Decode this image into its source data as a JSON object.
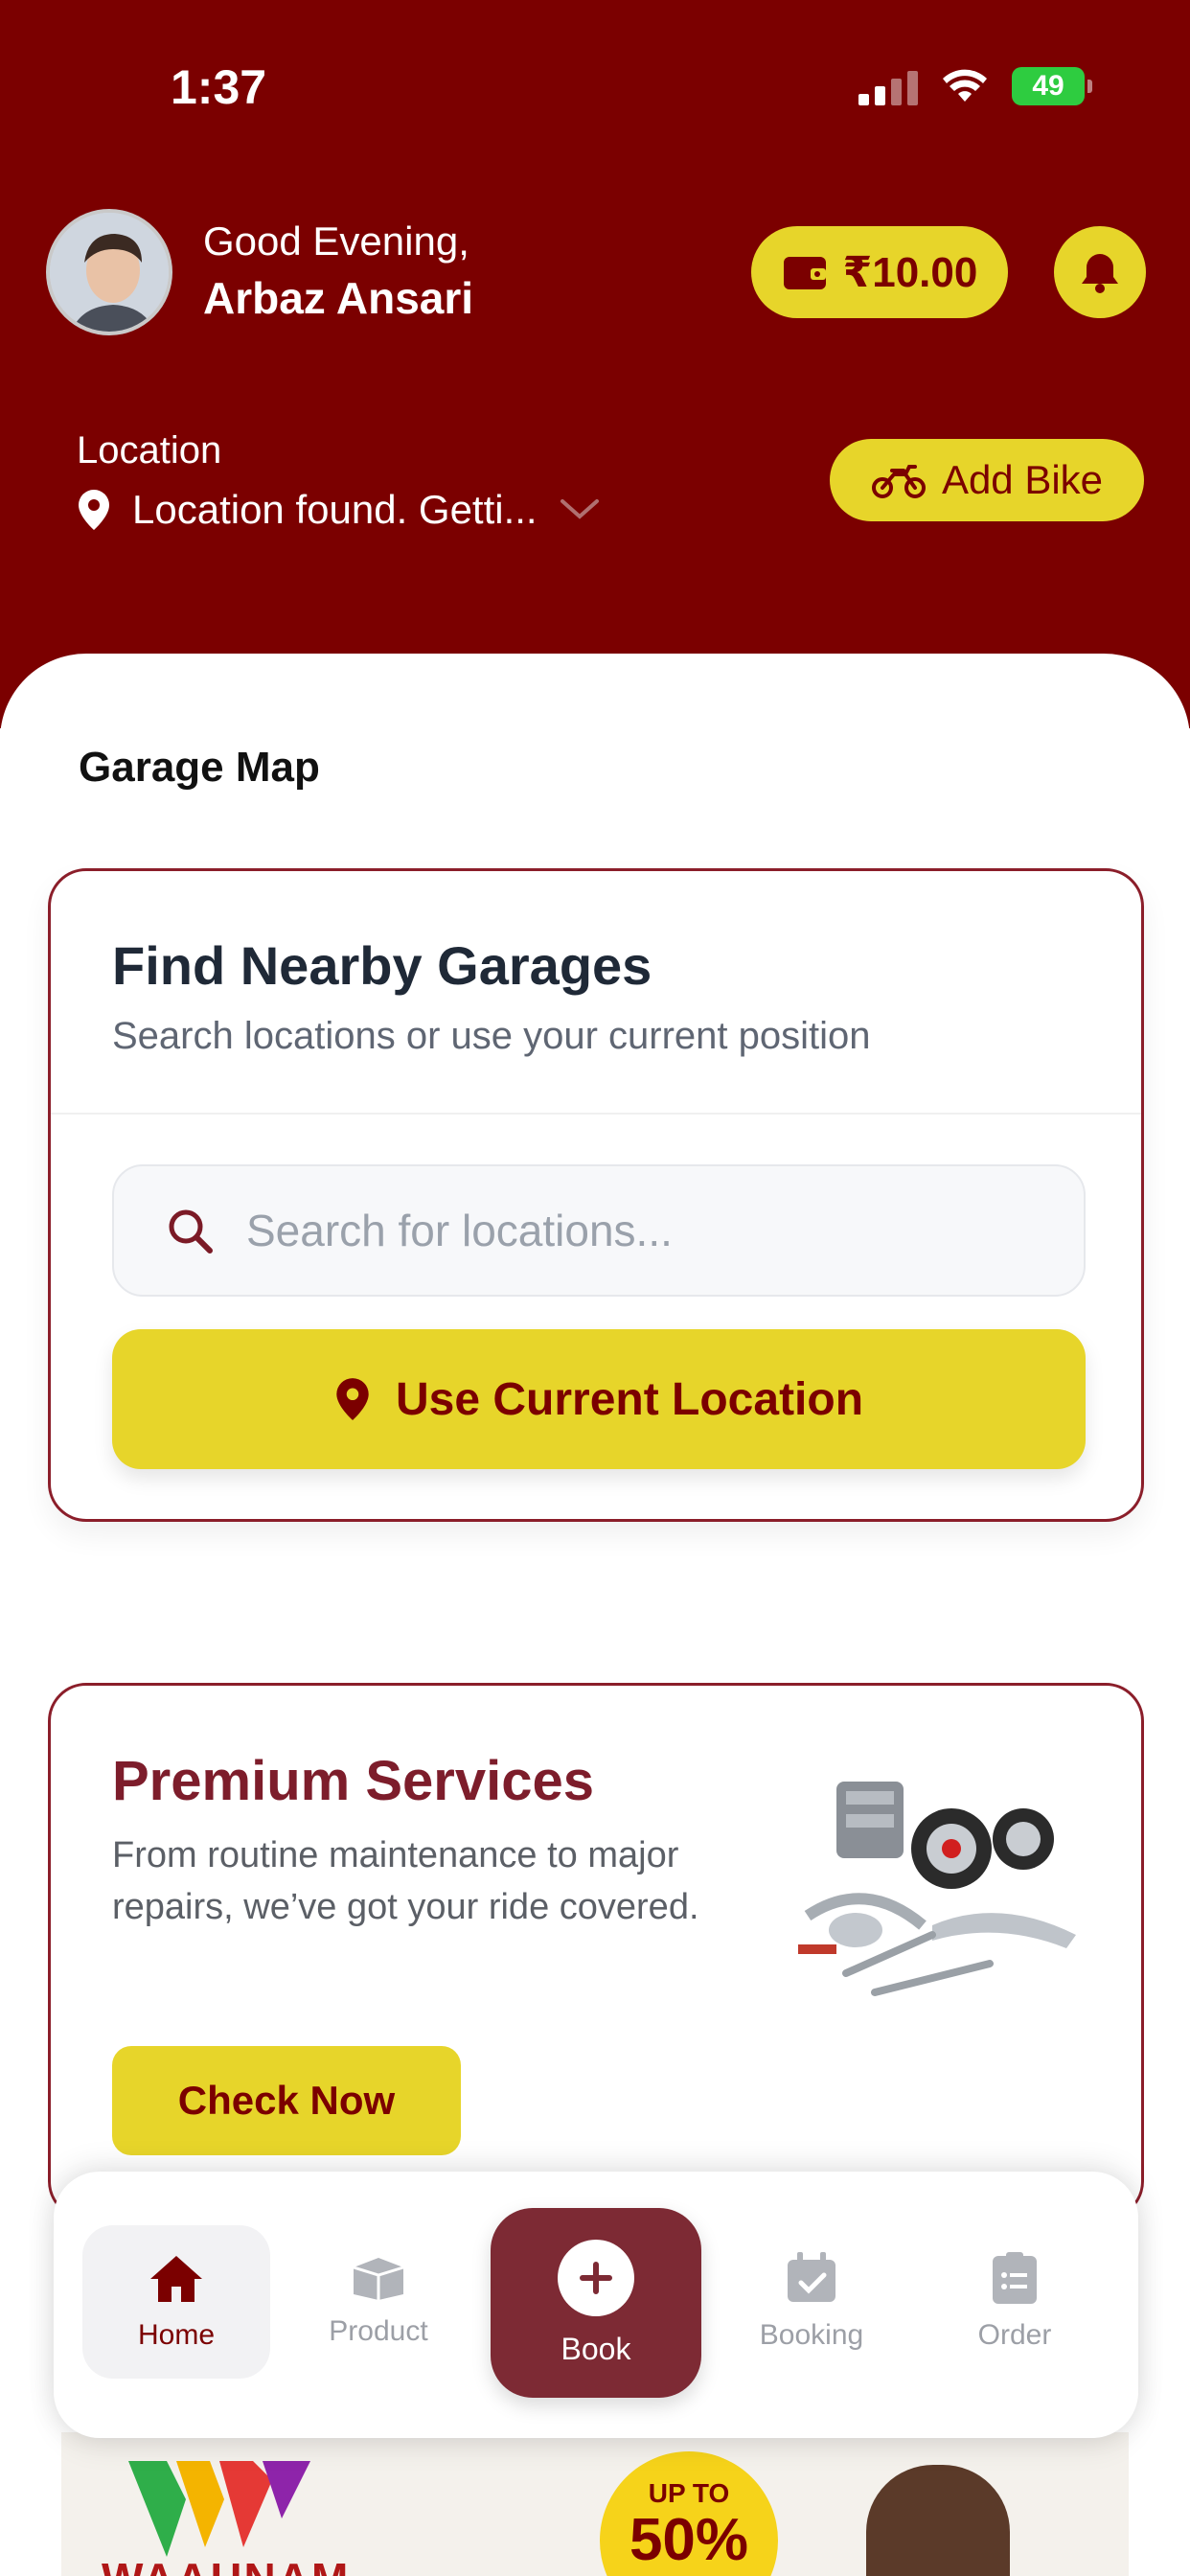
{
  "status_bar": {
    "time": "1:37",
    "battery": "49"
  },
  "header": {
    "greeting": "Good Evening,",
    "user_name": "Arbaz Ansari",
    "wallet_amount": "₹10.00",
    "location_label": "Location",
    "location_value": "Location found. Getti...",
    "add_bike_label": "Add Bike"
  },
  "garage_map": {
    "section_title": "Garage Map",
    "card_title": "Find Nearby Garages",
    "card_subtitle": "Search locations or use your current position",
    "search_placeholder": "Search for locations...",
    "use_location_label": "Use Current Location"
  },
  "premium": {
    "title": "Premium Services",
    "description": "From routine maintenance to major repairs, we’ve got your ride covered.",
    "button_label": "Check Now"
  },
  "bottom_nav": {
    "items": [
      {
        "label": "Home",
        "icon": "home-icon",
        "active": true
      },
      {
        "label": "Product",
        "icon": "box-icon",
        "active": false
      },
      {
        "label": "Book",
        "icon": "plus-icon",
        "active": false
      },
      {
        "label": "Booking",
        "icon": "calendar-check-icon",
        "active": false
      },
      {
        "label": "Order",
        "icon": "clipboard-icon",
        "active": false
      }
    ]
  },
  "banner": {
    "brand": "WAAHNAM",
    "badge_top": "UP TO",
    "badge_big": "50%"
  },
  "colors": {
    "primary": "#7b0000",
    "accent": "#e7d52a",
    "card_border": "#8b1e2a"
  }
}
